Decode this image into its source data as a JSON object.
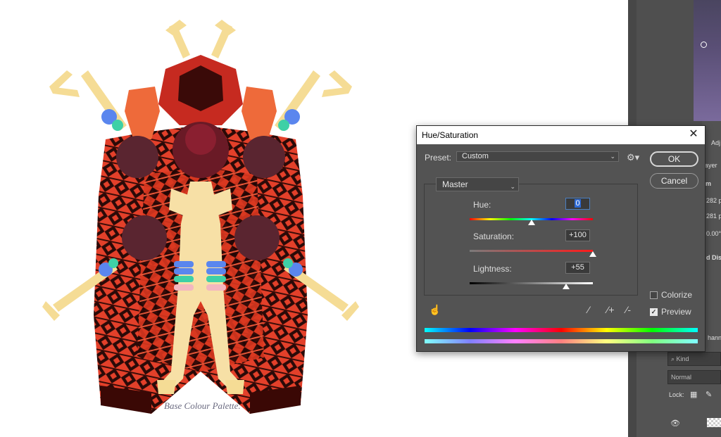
{
  "canvas": {
    "caption": "Base Colour Palette."
  },
  "dialog": {
    "title": "Hue/Saturation",
    "close_icon": "close-icon",
    "preset_label": "Preset:",
    "preset_value": "Custom",
    "ok_label": "OK",
    "cancel_label": "Cancel",
    "channel_value": "Master",
    "hue": {
      "label": "Hue:",
      "value": "0",
      "slider_fraction": 0.5
    },
    "saturation": {
      "label": "Saturation:",
      "value": "+100",
      "slider_fraction": 1.0
    },
    "lightness": {
      "label": "Lightness:",
      "value": "+55",
      "slider_fraction": 0.78
    },
    "colorize_label": "Colorize",
    "colorize_checked": false,
    "preview_label": "Preview",
    "preview_checked": true,
    "icons": [
      "hand-target-icon",
      "eyedropper-icon",
      "eyedropper-plus-icon",
      "eyedropper-minus-icon",
      "gear-icon"
    ]
  },
  "panels": {
    "tab_partial": "Adj",
    "layer_partial": "ayer",
    "w_partial": "m",
    "width_partial": "282 px",
    "height_partial": "281 px",
    "angle_partial": "0.00°",
    "disp_partial": "d Dis",
    "channels_partial": "hanne",
    "kind_label": "Kind",
    "blend_mode": "Normal",
    "lock_label": "Lock:"
  },
  "colors": {
    "dialog_bg": "#535353",
    "panel_bg": "#535353",
    "accent_red": "#e8412a",
    "accent_cream": "#f5dc95"
  }
}
